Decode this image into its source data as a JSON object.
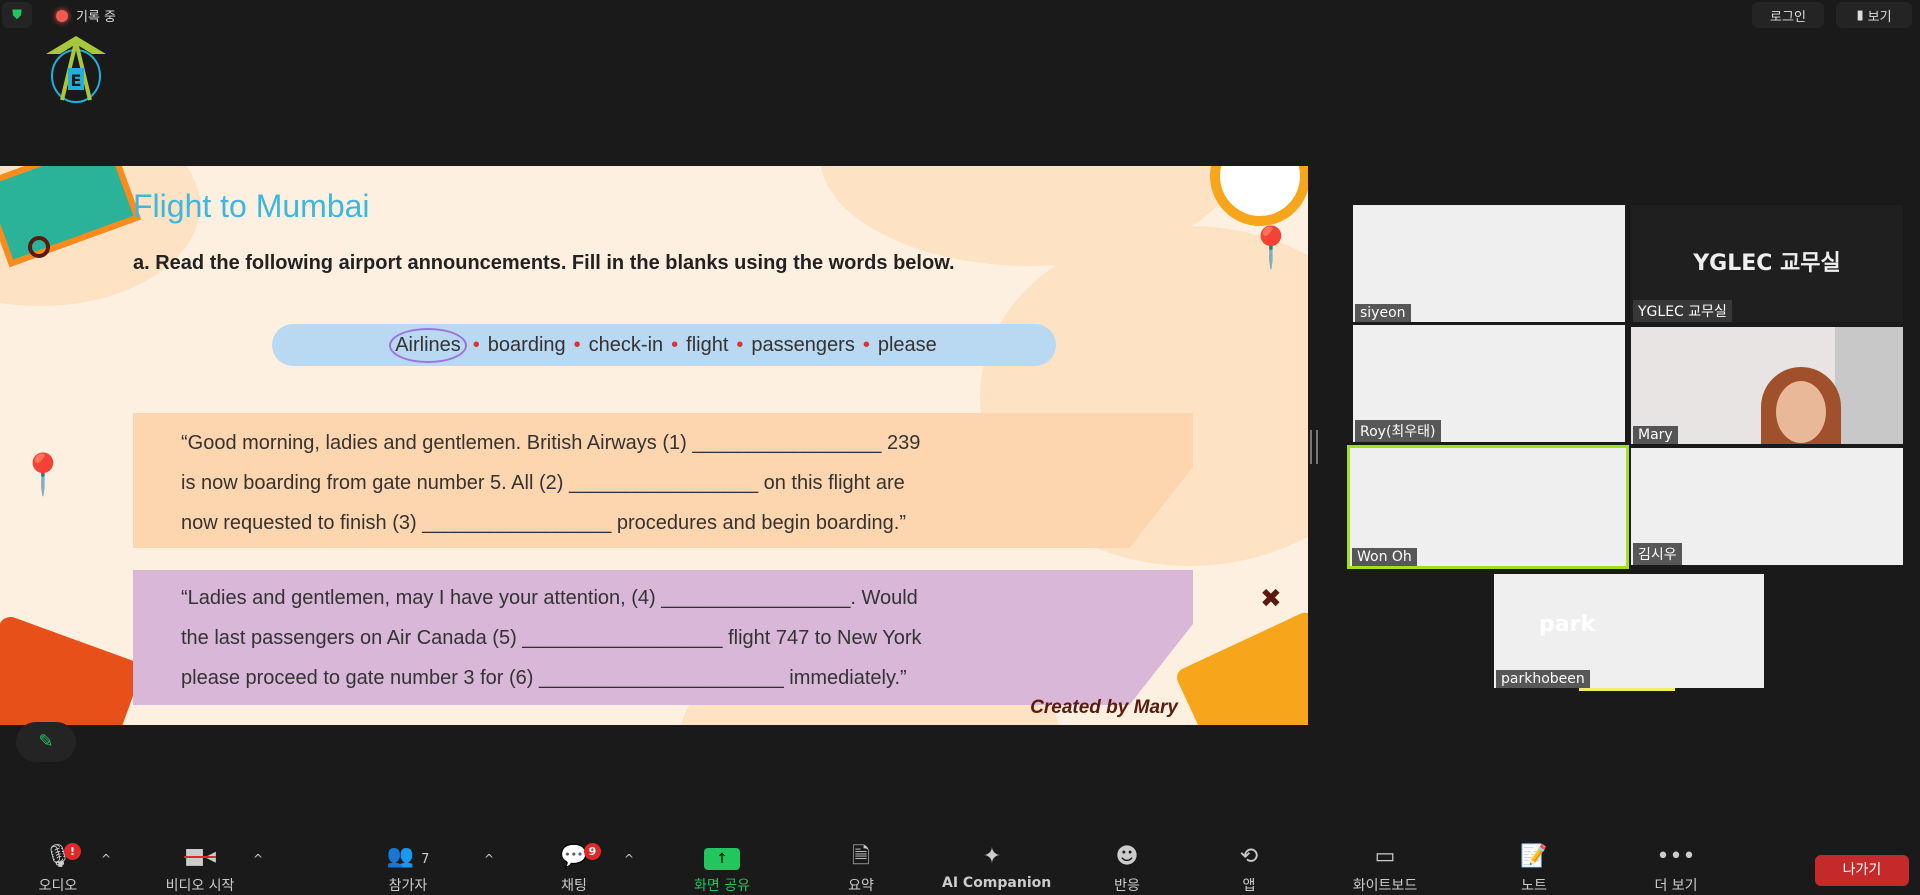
{
  "topbar": {
    "recording": "기록 중",
    "login": "로그인",
    "view": "보기"
  },
  "slide": {
    "title": "Flight to Mumbai",
    "instruction": "a. Read the following airport announcements. Fill in the blanks using the words below.",
    "words": [
      "Airlines",
      "boarding",
      "check-in",
      "flight",
      "passengers",
      "please"
    ],
    "paragraph1": [
      "“Good morning, ladies and gentlemen. British Airways (1) _________________ 239",
      "is now boarding from gate number 5. All (2) _________________ on this flight are",
      "now requested to finish (3) _________________ procedures and begin boarding.”"
    ],
    "paragraph2": [
      "“Ladies and gentlemen, may I have your attention, (4) _________________. Would",
      "the last passengers on Air Canada (5) __________________ flight 747 to New York",
      "please proceed to gate number 3 for (6) ______________________ immediately.”"
    ],
    "credit": "Created by Mary"
  },
  "participants": [
    {
      "name": "siyeon"
    },
    {
      "name": "YGLEC 교무실",
      "display": "YGLEC 교무실"
    },
    {
      "name": "Roy(최우태)"
    },
    {
      "name": "Mary"
    },
    {
      "name": "Won Oh",
      "active_speaker": true
    },
    {
      "name": "김시우"
    },
    {
      "name": "parkhobeen",
      "display": "park"
    }
  ],
  "toolbar": {
    "audio": "오디오",
    "audio_badge": "!",
    "video": "비디오 시작",
    "participants": "참가자",
    "participants_count": "7",
    "chat": "채팅",
    "chat_badge": "9",
    "share": "화면 공유",
    "summary": "요약",
    "ai": "AI Companion",
    "reactions": "반응",
    "apps": "앱",
    "whiteboard": "화이트보드",
    "notes": "노트",
    "more": "더 보기",
    "leave": "나가기"
  },
  "colors": {
    "share": "#22c55e",
    "leave": "#c52a2a",
    "active_speaker": "#9fe020",
    "title": "#3cb7e0"
  }
}
